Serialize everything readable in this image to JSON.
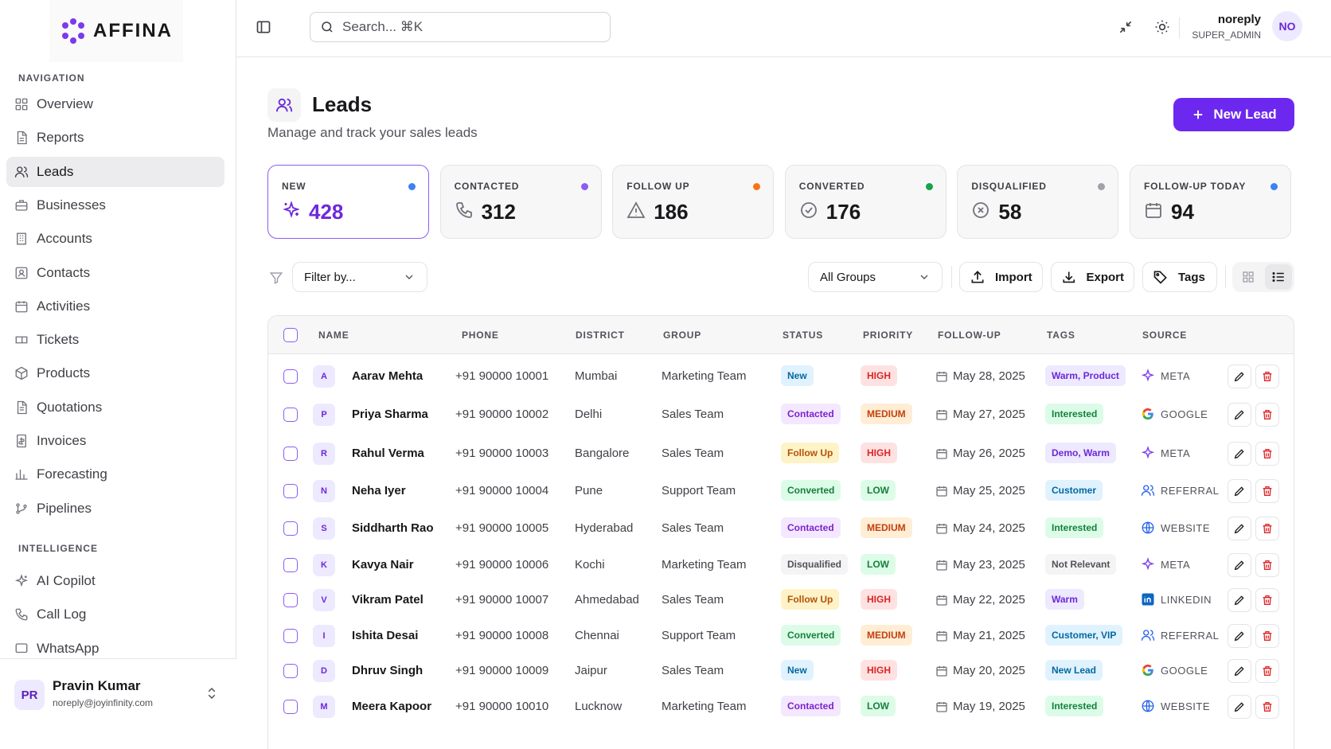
{
  "app": {
    "name": "AFFINA"
  },
  "sidebar": {
    "nav_label": "NAVIGATION",
    "items": [
      {
        "label": "Overview",
        "icon": "grid-icon"
      },
      {
        "label": "Reports",
        "icon": "file-icon"
      },
      {
        "label": "Leads",
        "icon": "users-icon",
        "active": true
      },
      {
        "label": "Businesses",
        "icon": "briefcase-icon"
      },
      {
        "label": "Accounts",
        "icon": "building-icon"
      },
      {
        "label": "Contacts",
        "icon": "contact-icon"
      },
      {
        "label": "Activities",
        "icon": "calendar-icon"
      },
      {
        "label": "Tickets",
        "icon": "ticket-icon"
      },
      {
        "label": "Products",
        "icon": "box-icon"
      },
      {
        "label": "Quotations",
        "icon": "file-text-icon"
      },
      {
        "label": "Invoices",
        "icon": "invoice-icon"
      },
      {
        "label": "Forecasting",
        "icon": "bar-chart-icon"
      },
      {
        "label": "Pipelines",
        "icon": "git-branch-icon"
      }
    ],
    "intel_label": "INTELLIGENCE",
    "intel_items": [
      {
        "label": "AI Copilot",
        "icon": "sparkles-icon"
      },
      {
        "label": "Call Log",
        "icon": "phone-icon"
      },
      {
        "label": "WhatsApp",
        "icon": "message-icon"
      }
    ],
    "user": {
      "initials": "PR",
      "name": "Pravin Kumar",
      "email": "noreply@joyinfinity.com"
    }
  },
  "topbar": {
    "search_placeholder": "Search... ⌘K",
    "user_name": "noreply",
    "user_role": "SUPER_ADMIN",
    "user_initials": "NO"
  },
  "page": {
    "title": "Leads",
    "subtitle": "Manage and track your sales leads",
    "new_button": "New Lead"
  },
  "stats": [
    {
      "label": "NEW",
      "value": "428",
      "dot": "#3b82f6",
      "icon": "sparkle-icon"
    },
    {
      "label": "CONTACTED",
      "value": "312",
      "dot": "#8b5cf6",
      "icon": "phone-icon"
    },
    {
      "label": "FOLLOW UP",
      "value": "186",
      "dot": "#f97316",
      "icon": "alert-icon"
    },
    {
      "label": "CONVERTED",
      "value": "176",
      "dot": "#16a34a",
      "icon": "check-circle-icon"
    },
    {
      "label": "DISQUALIFIED",
      "value": "58",
      "dot": "#a1a1aa",
      "icon": "x-circle-icon"
    },
    {
      "label": "FOLLOW-UP TODAY",
      "value": "94",
      "dot": "#3b82f6",
      "icon": "calendar-icon"
    }
  ],
  "toolbar": {
    "filter_placeholder": "Filter by...",
    "group_select": "All Groups",
    "import": "Import",
    "export": "Export",
    "tags": "Tags"
  },
  "table": {
    "columns": [
      "NAME",
      "PHONE",
      "DISTRICT",
      "GROUP",
      "STATUS",
      "PRIORITY",
      "FOLLOW-UP",
      "TAGS",
      "SOURCE"
    ],
    "rows": [
      {
        "initial": "A",
        "name": "Aarav Mehta",
        "phone": "+91 90000 10001",
        "district": "Mumbai",
        "group": "Marketing Team",
        "status": "New",
        "priority": "HIGH",
        "followup": "May 28, 2025",
        "tags": "Warm, Product",
        "source": "META"
      },
      {
        "initial": "P",
        "name": "Priya Sharma",
        "phone": "+91 90000 10002",
        "district": "Delhi",
        "group": "Sales Team",
        "status": "Contacted",
        "priority": "MEDIUM",
        "followup": "May 27, 2025",
        "tags": "Interested",
        "source": "GOOGLE"
      },
      {
        "initial": "R",
        "name": "Rahul Verma",
        "phone": "+91 90000 10003",
        "district": "Bangalore",
        "group": "Sales Team",
        "status": "Follow Up",
        "priority": "HIGH",
        "followup": "May 26, 2025",
        "tags": "Demo, Warm",
        "source": "META"
      },
      {
        "initial": "N",
        "name": "Neha Iyer",
        "phone": "+91 90000 10004",
        "district": "Pune",
        "group": "Support Team",
        "status": "Converted",
        "priority": "LOW",
        "followup": "May 25, 2025",
        "tags": "Customer",
        "source": "REFERRAL"
      },
      {
        "initial": "S",
        "name": "Siddharth Rao",
        "phone": "+91 90000 10005",
        "district": "Hyderabad",
        "group": "Sales Team",
        "status": "Contacted",
        "priority": "MEDIUM",
        "followup": "May 24, 2025",
        "tags": "Interested",
        "source": "WEBSITE"
      },
      {
        "initial": "K",
        "name": "Kavya Nair",
        "phone": "+91 90000 10006",
        "district": "Kochi",
        "group": "Marketing Team",
        "status": "Disqualified",
        "priority": "LOW",
        "followup": "May 23, 2025",
        "tags": "Not Relevant",
        "source": "META"
      },
      {
        "initial": "V",
        "name": "Vikram Patel",
        "phone": "+91 90000 10007",
        "district": "Ahmedabad",
        "group": "Sales Team",
        "status": "Follow Up",
        "priority": "HIGH",
        "followup": "May 22, 2025",
        "tags": "Warm",
        "source": "LINKEDIN"
      },
      {
        "initial": "I",
        "name": "Ishita Desai",
        "phone": "+91 90000 10008",
        "district": "Chennai",
        "group": "Support Team",
        "status": "Converted",
        "priority": "MEDIUM",
        "followup": "May 21, 2025",
        "tags": "Customer, VIP",
        "source": "REFERRAL"
      },
      {
        "initial": "D",
        "name": "Dhruv Singh",
        "phone": "+91 90000 10009",
        "district": "Jaipur",
        "group": "Sales Team",
        "status": "New",
        "priority": "HIGH",
        "followup": "May 20, 2025",
        "tags": "New Lead",
        "source": "GOOGLE"
      },
      {
        "initial": "M",
        "name": "Meera Kapoor",
        "phone": "+91 90000 10010",
        "district": "Lucknow",
        "group": "Marketing Team",
        "status": "Contacted",
        "priority": "LOW",
        "followup": "May 19, 2025",
        "tags": "Interested",
        "source": "WEBSITE"
      }
    ]
  }
}
